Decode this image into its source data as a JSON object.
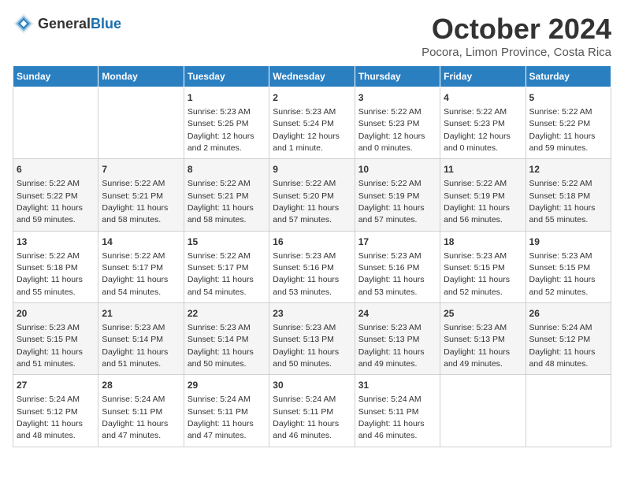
{
  "header": {
    "logo_general": "General",
    "logo_blue": "Blue",
    "month_title": "October 2024",
    "location": "Pocora, Limon Province, Costa Rica"
  },
  "days_of_week": [
    "Sunday",
    "Monday",
    "Tuesday",
    "Wednesday",
    "Thursday",
    "Friday",
    "Saturday"
  ],
  "weeks": [
    [
      {
        "day": "",
        "content": ""
      },
      {
        "day": "",
        "content": ""
      },
      {
        "day": "1",
        "content": "Sunrise: 5:23 AM\nSunset: 5:25 PM\nDaylight: 12 hours\nand 2 minutes."
      },
      {
        "day": "2",
        "content": "Sunrise: 5:23 AM\nSunset: 5:24 PM\nDaylight: 12 hours\nand 1 minute."
      },
      {
        "day": "3",
        "content": "Sunrise: 5:22 AM\nSunset: 5:23 PM\nDaylight: 12 hours\nand 0 minutes."
      },
      {
        "day": "4",
        "content": "Sunrise: 5:22 AM\nSunset: 5:23 PM\nDaylight: 12 hours\nand 0 minutes."
      },
      {
        "day": "5",
        "content": "Sunrise: 5:22 AM\nSunset: 5:22 PM\nDaylight: 11 hours\nand 59 minutes."
      }
    ],
    [
      {
        "day": "6",
        "content": "Sunrise: 5:22 AM\nSunset: 5:22 PM\nDaylight: 11 hours\nand 59 minutes."
      },
      {
        "day": "7",
        "content": "Sunrise: 5:22 AM\nSunset: 5:21 PM\nDaylight: 11 hours\nand 58 minutes."
      },
      {
        "day": "8",
        "content": "Sunrise: 5:22 AM\nSunset: 5:21 PM\nDaylight: 11 hours\nand 58 minutes."
      },
      {
        "day": "9",
        "content": "Sunrise: 5:22 AM\nSunset: 5:20 PM\nDaylight: 11 hours\nand 57 minutes."
      },
      {
        "day": "10",
        "content": "Sunrise: 5:22 AM\nSunset: 5:19 PM\nDaylight: 11 hours\nand 57 minutes."
      },
      {
        "day": "11",
        "content": "Sunrise: 5:22 AM\nSunset: 5:19 PM\nDaylight: 11 hours\nand 56 minutes."
      },
      {
        "day": "12",
        "content": "Sunrise: 5:22 AM\nSunset: 5:18 PM\nDaylight: 11 hours\nand 55 minutes."
      }
    ],
    [
      {
        "day": "13",
        "content": "Sunrise: 5:22 AM\nSunset: 5:18 PM\nDaylight: 11 hours\nand 55 minutes."
      },
      {
        "day": "14",
        "content": "Sunrise: 5:22 AM\nSunset: 5:17 PM\nDaylight: 11 hours\nand 54 minutes."
      },
      {
        "day": "15",
        "content": "Sunrise: 5:22 AM\nSunset: 5:17 PM\nDaylight: 11 hours\nand 54 minutes."
      },
      {
        "day": "16",
        "content": "Sunrise: 5:23 AM\nSunset: 5:16 PM\nDaylight: 11 hours\nand 53 minutes."
      },
      {
        "day": "17",
        "content": "Sunrise: 5:23 AM\nSunset: 5:16 PM\nDaylight: 11 hours\nand 53 minutes."
      },
      {
        "day": "18",
        "content": "Sunrise: 5:23 AM\nSunset: 5:15 PM\nDaylight: 11 hours\nand 52 minutes."
      },
      {
        "day": "19",
        "content": "Sunrise: 5:23 AM\nSunset: 5:15 PM\nDaylight: 11 hours\nand 52 minutes."
      }
    ],
    [
      {
        "day": "20",
        "content": "Sunrise: 5:23 AM\nSunset: 5:15 PM\nDaylight: 11 hours\nand 51 minutes."
      },
      {
        "day": "21",
        "content": "Sunrise: 5:23 AM\nSunset: 5:14 PM\nDaylight: 11 hours\nand 51 minutes."
      },
      {
        "day": "22",
        "content": "Sunrise: 5:23 AM\nSunset: 5:14 PM\nDaylight: 11 hours\nand 50 minutes."
      },
      {
        "day": "23",
        "content": "Sunrise: 5:23 AM\nSunset: 5:13 PM\nDaylight: 11 hours\nand 50 minutes."
      },
      {
        "day": "24",
        "content": "Sunrise: 5:23 AM\nSunset: 5:13 PM\nDaylight: 11 hours\nand 49 minutes."
      },
      {
        "day": "25",
        "content": "Sunrise: 5:23 AM\nSunset: 5:13 PM\nDaylight: 11 hours\nand 49 minutes."
      },
      {
        "day": "26",
        "content": "Sunrise: 5:24 AM\nSunset: 5:12 PM\nDaylight: 11 hours\nand 48 minutes."
      }
    ],
    [
      {
        "day": "27",
        "content": "Sunrise: 5:24 AM\nSunset: 5:12 PM\nDaylight: 11 hours\nand 48 minutes."
      },
      {
        "day": "28",
        "content": "Sunrise: 5:24 AM\nSunset: 5:11 PM\nDaylight: 11 hours\nand 47 minutes."
      },
      {
        "day": "29",
        "content": "Sunrise: 5:24 AM\nSunset: 5:11 PM\nDaylight: 11 hours\nand 47 minutes."
      },
      {
        "day": "30",
        "content": "Sunrise: 5:24 AM\nSunset: 5:11 PM\nDaylight: 11 hours\nand 46 minutes."
      },
      {
        "day": "31",
        "content": "Sunrise: 5:24 AM\nSunset: 5:11 PM\nDaylight: 11 hours\nand 46 minutes."
      },
      {
        "day": "",
        "content": ""
      },
      {
        "day": "",
        "content": ""
      }
    ]
  ]
}
